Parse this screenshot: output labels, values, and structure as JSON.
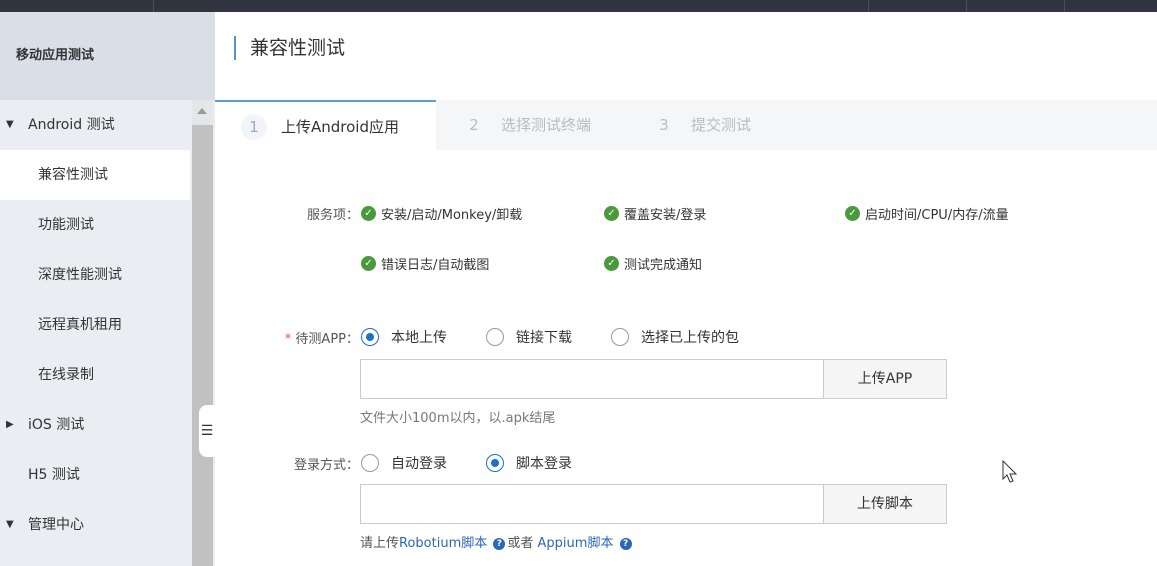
{
  "sidebar": {
    "title": "移动应用测试",
    "items": [
      {
        "label": "Android 测试",
        "type": "group",
        "expanded": true
      },
      {
        "label": "兼容性测试",
        "type": "sub",
        "active": true
      },
      {
        "label": "功能测试",
        "type": "sub"
      },
      {
        "label": "深度性能测试",
        "type": "sub"
      },
      {
        "label": "远程真机租用",
        "type": "sub"
      },
      {
        "label": "在线录制",
        "type": "sub"
      },
      {
        "label": "iOS 测试",
        "type": "group",
        "expanded": false
      },
      {
        "label": "H5 测试",
        "type": "plain"
      },
      {
        "label": "管理中心",
        "type": "group",
        "expanded": true
      }
    ]
  },
  "main": {
    "title": "兼容性测试",
    "steps": [
      {
        "num": "1",
        "label": "上传Android应用"
      },
      {
        "num": "2",
        "label": "选择测试终端"
      },
      {
        "num": "3",
        "label": "提交测试"
      }
    ],
    "services": {
      "label": "服务项：",
      "items": [
        "安装/启动/Monkey/卸载",
        "覆盖安装/登录",
        "启动时间/CPU/内存/流量",
        "错误日志/自动截图",
        "测试完成通知"
      ]
    },
    "app": {
      "required": "*",
      "label": "待测APP：",
      "options": [
        "本地上传",
        "链接下载",
        "选择已上传的包"
      ],
      "selected": 0,
      "value": "",
      "button": "上传APP",
      "hint": "文件大小100m以内，以.apk结尾"
    },
    "login": {
      "label": "登录方式：",
      "options": [
        "自动登录",
        "脚本登录"
      ],
      "selected": 1,
      "value": "",
      "button": "上传脚本",
      "hint_prefix": "请上传",
      "link1": "Robotium脚本",
      "hint_mid": "或者 ",
      "link2": "Appium脚本",
      "help_glyph": "?"
    }
  }
}
